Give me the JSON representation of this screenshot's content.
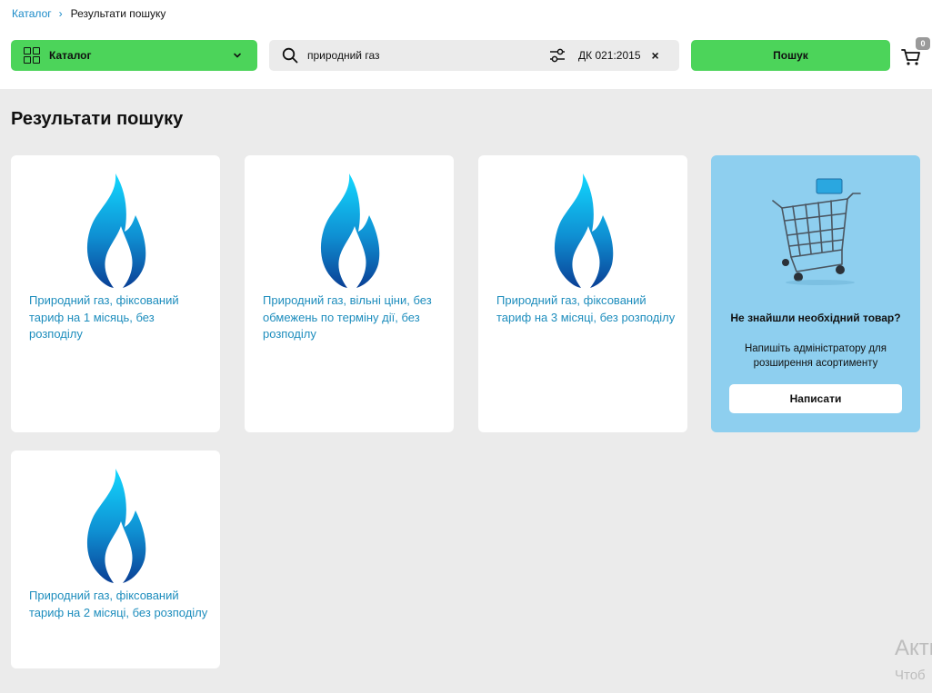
{
  "breadcrumb": {
    "root": "Каталог",
    "separator": "›",
    "current": "Результати пошуку"
  },
  "header": {
    "catalog_label": "Каталог",
    "search_value": "природний газ",
    "filter_tag": "ДК 021:2015",
    "clear_symbol": "×",
    "search_button": "Пошук",
    "cart_count": "0"
  },
  "page_title": "Результати пошуку",
  "products": [
    {
      "title": "Природний газ, фіксований тариф на 1 місяць, без розподілу",
      "icon": "gas-flame-icon"
    },
    {
      "title": "Природний газ, вільні ціни, без обмежень по терміну дії, без розподілу",
      "icon": "gas-flame-icon"
    },
    {
      "title": "Природний газ, фіксований тариф на 3 місяці, без розподілу",
      "icon": "gas-flame-icon"
    },
    {
      "title": "Природний газ, фіксований тариф на 2 місяці, без розподілу",
      "icon": "gas-flame-icon"
    }
  ],
  "help_card": {
    "title": "Не знайшли необхідний товар?",
    "text": "Напишіть адміністратору для розширення асортименту",
    "button": "Написати"
  },
  "watermark": {
    "line1": "Акти",
    "line2": "Чтоб"
  },
  "colors": {
    "accent_green": "#4cd45a",
    "link_blue": "#1d8dbd",
    "help_bg": "#8ecfef",
    "page_bg": "#ebebeb"
  }
}
